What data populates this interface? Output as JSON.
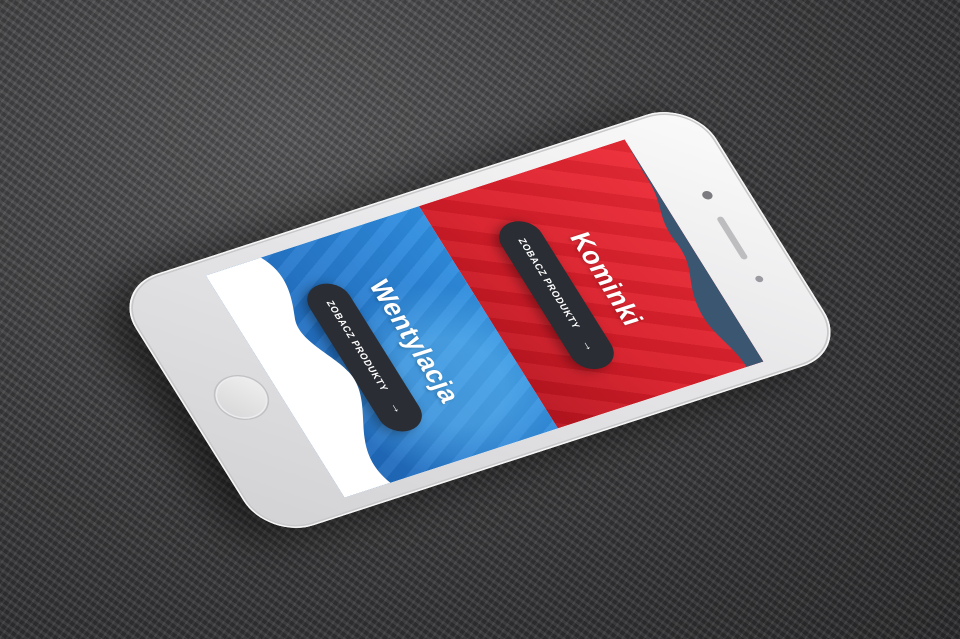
{
  "sections": [
    {
      "title": "Kominki",
      "cta_label": "ZOBACZ PRODUKTY",
      "cta_icon": "arrow-right-icon",
      "color": "#e0232e"
    },
    {
      "title": "Wentylacja",
      "cta_label": "ZOBACZ PRODUKTY",
      "cta_icon": "arrow-right-icon",
      "color": "#2a82d6"
    }
  ],
  "colors": {
    "header_bar": "#3b5670",
    "button_bg": "#2a2d33",
    "wave": "#ffffff"
  }
}
